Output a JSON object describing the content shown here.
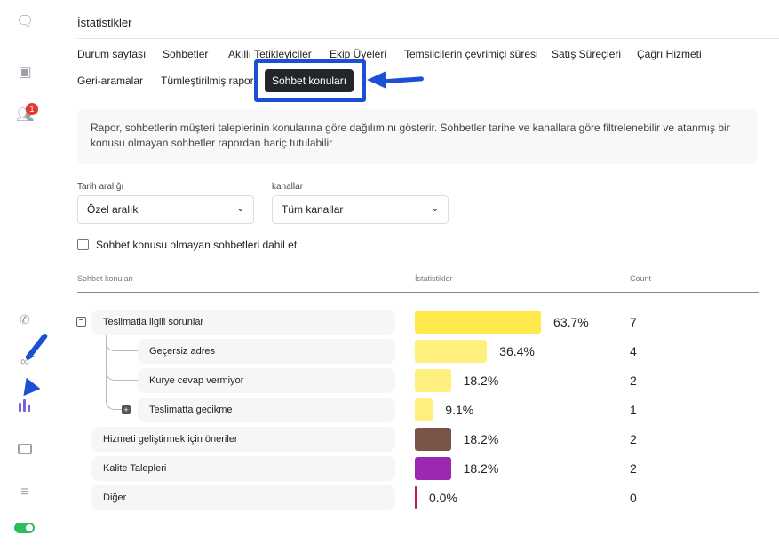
{
  "header": {
    "title": "İstatistikler"
  },
  "sidebar": {
    "badge_users": "1",
    "badge_bot": "1"
  },
  "tabs": [
    "Durum sayfası",
    "Sohbetler",
    "Akıllı Tetikleyiciler",
    "Ekip Üyeleri",
    "Temsilcilerin çevrimiçi süresi",
    "Satış Süreçleri",
    "Çağrı Hizmeti",
    "Geri-aramalar",
    "Tümleştirilmiş rapor",
    "Sohbet konuları"
  ],
  "active_tab": "Sohbet konuları",
  "info": "Rapor, sohbetlerin müşteri taleplerinin konularına göre dağılımını gösterir. Sohbetler tarihe ve kanallara göre filtrelenebilir ve atanmış bir konusu olmayan sohbetler rapordan hariç tutulabilir",
  "filters": {
    "date_label": "Tarih aralığı",
    "date_value": "Özel aralık",
    "channel_label": "kanallar",
    "channel_value": "Tüm kanallar",
    "checkbox_label": "Sohbet konusu olmayan sohbetleri dahil et"
  },
  "table": {
    "headers": [
      "Sohbet konuları",
      "İstatistikler",
      "Count"
    ],
    "rows": [
      {
        "label": "Teslimatla ilgili sorunlar",
        "pct": "63.7%",
        "value": 63.7,
        "count": "7",
        "color": "#ffe94a",
        "level": 0
      },
      {
        "label": "Geçersiz adres",
        "pct": "36.4%",
        "value": 36.4,
        "count": "4",
        "color": "#fff07e",
        "level": 1
      },
      {
        "label": "Kurye cevap vermiyor",
        "pct": "18.2%",
        "value": 18.2,
        "count": "2",
        "color": "#fff07e",
        "level": 1
      },
      {
        "label": "Teslimatta gecikme",
        "pct": "9.1%",
        "value": 9.1,
        "count": "1",
        "color": "#fff07e",
        "level": 1
      },
      {
        "label": "Hizmeti geliştirmek için öneriler",
        "pct": "18.2%",
        "value": 18.2,
        "count": "2",
        "color": "#795548",
        "level": 0
      },
      {
        "label": "Kalite Talepleri",
        "pct": "18.2%",
        "value": 18.2,
        "count": "2",
        "color": "#9c27b0",
        "level": 0
      },
      {
        "label": "Diğer",
        "pct": "0.0%",
        "value": 0,
        "count": "0",
        "color": "#c2185b",
        "level": 0
      }
    ]
  }
}
